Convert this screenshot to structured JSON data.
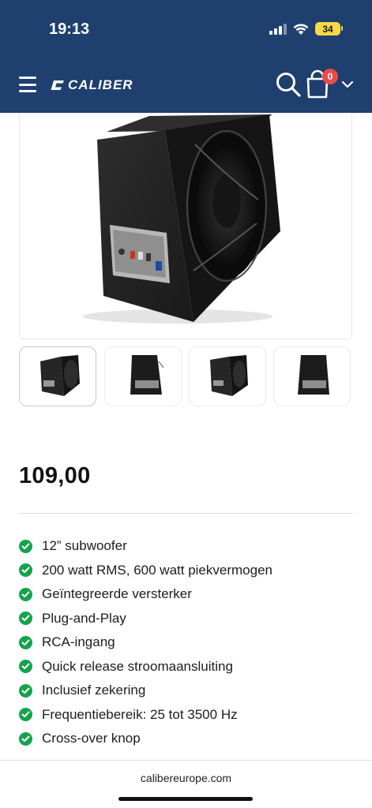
{
  "status_bar": {
    "time": "19:13",
    "battery": "34"
  },
  "header": {
    "brand": "CALIBER",
    "cart_count": "0"
  },
  "product": {
    "price": "109,00"
  },
  "features": [
    "12” subwoofer",
    "200 watt RMS, 600 watt piekvermogen",
    "Geïntegreerde versterker",
    "Plug-and-Play",
    "RCA-ingang",
    "Quick release stroomaansluiting",
    "Inclusief zekering",
    "Frequentiebereik: 25 tot 3500 Hz",
    "Cross-over knop"
  ],
  "browser": {
    "url": "calibereurope.com"
  },
  "colors": {
    "header_bg": "#1f3f6e",
    "check_green": "#15a34a",
    "badge_red": "#e84b4b",
    "battery_yellow": "#f5d94a"
  }
}
